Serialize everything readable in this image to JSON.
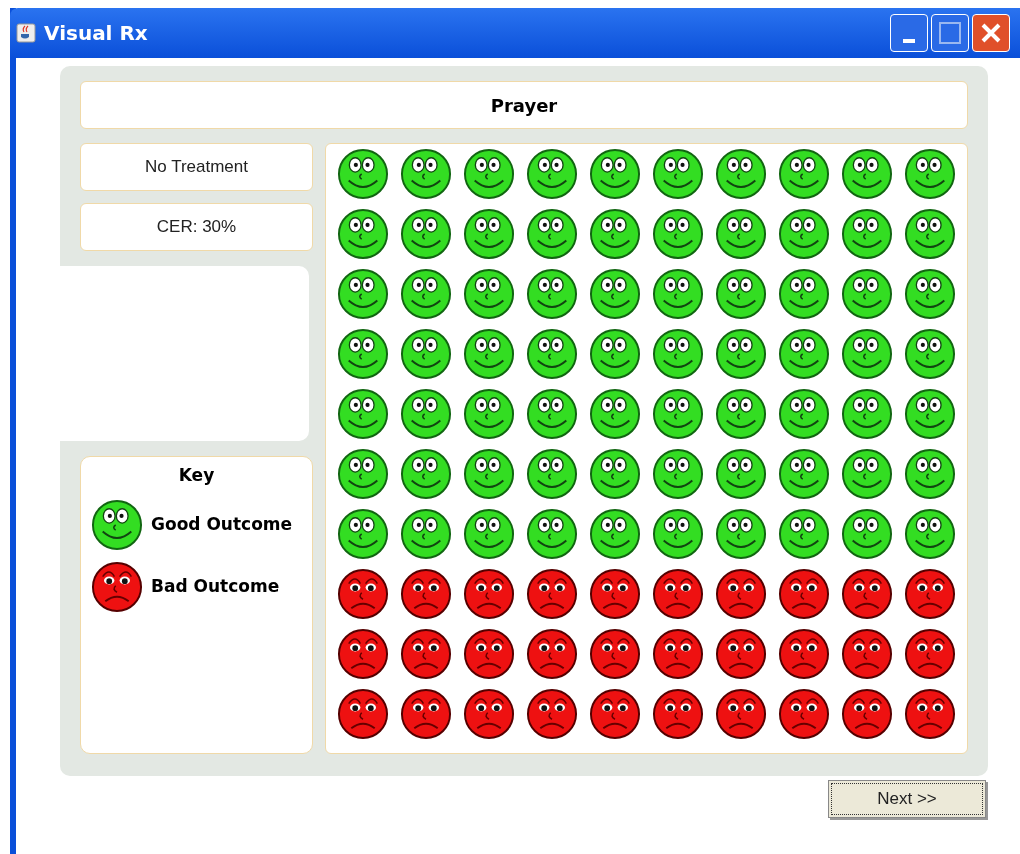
{
  "window": {
    "title": "Visual Rx"
  },
  "heading": "Prayer",
  "group_label": "No Treatment",
  "rate_label": "CER: 30%",
  "key": {
    "title": "Key",
    "items": [
      {
        "kind": "good",
        "label": "Good Outcome"
      },
      {
        "kind": "bad",
        "label": "Bad Outcome"
      }
    ]
  },
  "grid": {
    "rows": [
      [
        {
          "kind": "good"
        },
        {
          "kind": "good"
        },
        {
          "kind": "good"
        },
        {
          "kind": "good"
        },
        {
          "kind": "good"
        },
        {
          "kind": "good"
        },
        {
          "kind": "good"
        },
        {
          "kind": "good"
        },
        {
          "kind": "good"
        },
        {
          "kind": "good"
        }
      ],
      [
        {
          "kind": "good"
        },
        {
          "kind": "good"
        },
        {
          "kind": "good"
        },
        {
          "kind": "good"
        },
        {
          "kind": "good"
        },
        {
          "kind": "good"
        },
        {
          "kind": "good"
        },
        {
          "kind": "good"
        },
        {
          "kind": "good"
        },
        {
          "kind": "good"
        }
      ],
      [
        {
          "kind": "good"
        },
        {
          "kind": "good"
        },
        {
          "kind": "good"
        },
        {
          "kind": "good"
        },
        {
          "kind": "good"
        },
        {
          "kind": "good"
        },
        {
          "kind": "good"
        },
        {
          "kind": "good"
        },
        {
          "kind": "good"
        },
        {
          "kind": "good"
        }
      ],
      [
        {
          "kind": "good"
        },
        {
          "kind": "good"
        },
        {
          "kind": "good"
        },
        {
          "kind": "good"
        },
        {
          "kind": "good"
        },
        {
          "kind": "good"
        },
        {
          "kind": "good"
        },
        {
          "kind": "good"
        },
        {
          "kind": "good"
        },
        {
          "kind": "good"
        }
      ],
      [
        {
          "kind": "good"
        },
        {
          "kind": "good"
        },
        {
          "kind": "good"
        },
        {
          "kind": "good"
        },
        {
          "kind": "good"
        },
        {
          "kind": "good"
        },
        {
          "kind": "good"
        },
        {
          "kind": "good"
        },
        {
          "kind": "good"
        },
        {
          "kind": "good"
        }
      ],
      [
        {
          "kind": "good"
        },
        {
          "kind": "good"
        },
        {
          "kind": "good"
        },
        {
          "kind": "good"
        },
        {
          "kind": "good"
        },
        {
          "kind": "good"
        },
        {
          "kind": "good"
        },
        {
          "kind": "good"
        },
        {
          "kind": "good"
        },
        {
          "kind": "good"
        }
      ],
      [
        {
          "kind": "good"
        },
        {
          "kind": "good"
        },
        {
          "kind": "good"
        },
        {
          "kind": "good"
        },
        {
          "kind": "good"
        },
        {
          "kind": "good"
        },
        {
          "kind": "good"
        },
        {
          "kind": "good"
        },
        {
          "kind": "good"
        },
        {
          "kind": "good"
        }
      ],
      [
        {
          "kind": "bad"
        },
        {
          "kind": "bad"
        },
        {
          "kind": "bad"
        },
        {
          "kind": "bad"
        },
        {
          "kind": "bad"
        },
        {
          "kind": "bad"
        },
        {
          "kind": "bad"
        },
        {
          "kind": "bad"
        },
        {
          "kind": "bad"
        },
        {
          "kind": "bad"
        }
      ],
      [
        {
          "kind": "bad"
        },
        {
          "kind": "bad"
        },
        {
          "kind": "bad"
        },
        {
          "kind": "bad"
        },
        {
          "kind": "bad"
        },
        {
          "kind": "bad"
        },
        {
          "kind": "bad"
        },
        {
          "kind": "bad"
        },
        {
          "kind": "bad"
        },
        {
          "kind": "bad"
        }
      ],
      [
        {
          "kind": "bad"
        },
        {
          "kind": "bad"
        },
        {
          "kind": "bad"
        },
        {
          "kind": "bad"
        },
        {
          "kind": "bad"
        },
        {
          "kind": "bad"
        },
        {
          "kind": "bad"
        },
        {
          "kind": "bad"
        },
        {
          "kind": "bad"
        },
        {
          "kind": "bad"
        }
      ]
    ]
  },
  "buttons": {
    "next": "Next >>"
  }
}
